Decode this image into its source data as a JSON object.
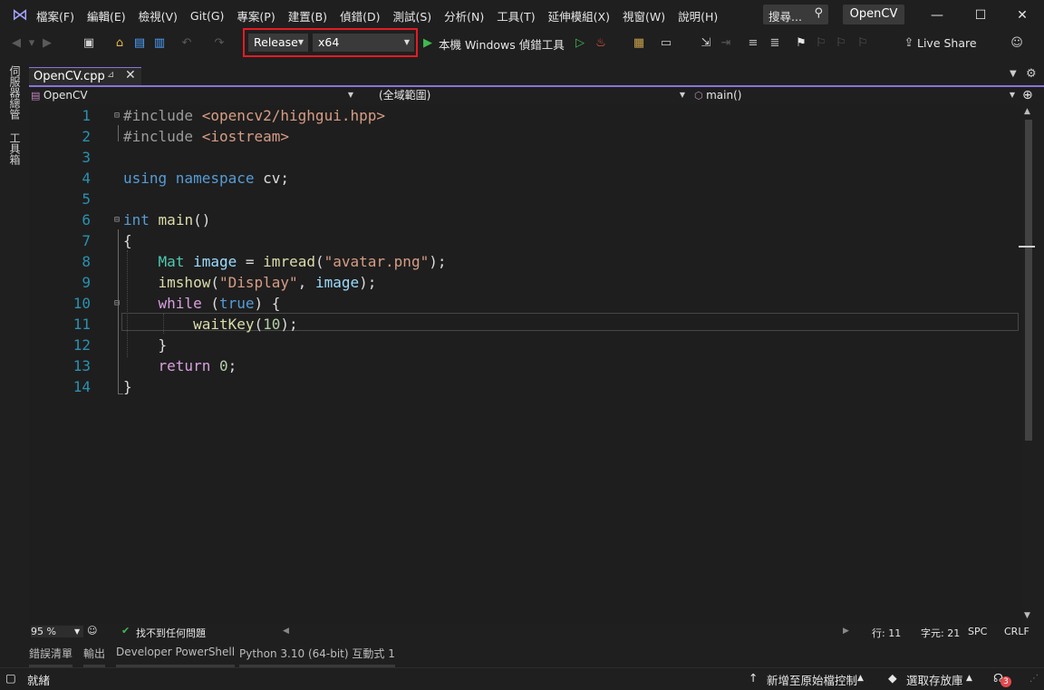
{
  "window": {
    "menus": [
      "檔案(F)",
      "編輯(E)",
      "檢視(V)",
      "Git(G)",
      "專案(P)",
      "建置(B)",
      "偵錯(D)",
      "測試(S)",
      "分析(N)",
      "工具(T)",
      "延伸模組(X)",
      "視窗(W)",
      "說明(H)"
    ],
    "search_label": "搜尋...",
    "solution_name": "OpenCV",
    "controls": {
      "minimize": "—",
      "maximize": "☐",
      "close": "✕"
    }
  },
  "toolbar": {
    "configuration": "Release",
    "platform": "x64",
    "run_label": "本機 Windows 偵錯工具",
    "live_share": "Live Share"
  },
  "left_strip": {
    "tab1": "伺服器總管",
    "tab2": "工具箱"
  },
  "editor_tab": {
    "filename": "OpenCV.cpp",
    "pin": "⊿",
    "close": "✕"
  },
  "navbar": {
    "project": "OpenCV",
    "scope": "(全域範圍)",
    "member": "main()"
  },
  "code_lines": [
    {
      "n": "1"
    },
    {
      "n": "2"
    },
    {
      "n": "3"
    },
    {
      "n": "4"
    },
    {
      "n": "5"
    },
    {
      "n": "6"
    },
    {
      "n": "7"
    },
    {
      "n": "8"
    },
    {
      "n": "9"
    },
    {
      "n": "10"
    },
    {
      "n": "11"
    },
    {
      "n": "12"
    },
    {
      "n": "13"
    },
    {
      "n": "14"
    }
  ],
  "code": {
    "l1_dir": "#include",
    "l1_path": "<opencv2/highgui.hpp>",
    "l2_dir": "#include",
    "l2_path": "<iostream>",
    "l4_kw": "using namespace",
    "l4_rest": "cv;",
    "l6_kw": "int",
    "l6_fn": "main",
    "l6_rest": "()",
    "l7": "{",
    "l8_ty": "Mat",
    "l8_var": "image",
    "l8_op": "=",
    "l8_fn": "imread",
    "l8_str": "\"avatar.png\"",
    "l9_fn": "imshow",
    "l9_str": "\"Display\"",
    "l9_var": "image",
    "l10_kw": "while",
    "l10_val": "true",
    "l11_fn": "waitKey",
    "l11_num": "10",
    "l12": "}",
    "l13_kw": "return",
    "l13_num": "0",
    "l14": "}"
  },
  "editor_status": {
    "zoom": "95 %",
    "issues": "找不到任何問題",
    "line": "行: 11",
    "col": "字元: 21",
    "spacing": "SPC",
    "eol": "CRLF"
  },
  "tool_tabs": [
    "錯誤清單",
    "輸出",
    "Developer PowerShell",
    "Python 3.10 (64-bit) 互動式 1"
  ],
  "statusbar": {
    "ready": "就緒",
    "add_source": "新增至原始檔控制",
    "select_repo": "選取存放庫",
    "notifications": "3"
  },
  "colors": {
    "highlight_box": "#e51b24",
    "accent": "#8a73d9",
    "line_numbers": "#2b91af"
  }
}
